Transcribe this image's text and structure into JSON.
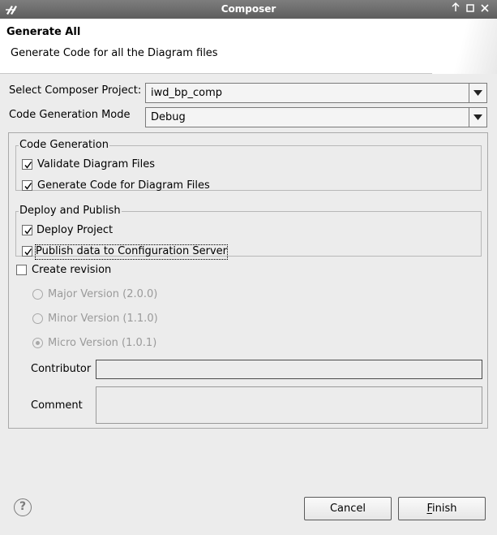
{
  "window": {
    "title": "Composer",
    "controls": [
      "pin-icon",
      "maximize-icon",
      "close-icon"
    ]
  },
  "banner": {
    "title": "Generate All",
    "description": "Generate Code for all the Diagram files"
  },
  "form": {
    "project_label": "Select Composer Project:",
    "project_value": "iwd_bp_comp",
    "mode_label": "Code Generation Mode",
    "mode_value": "Debug"
  },
  "code_generation": {
    "title": "Code Generation",
    "validate_label": "Validate Diagram Files",
    "validate_checked": true,
    "generate_label": "Generate Code for Diagram Files",
    "generate_checked": true
  },
  "deploy_publish": {
    "title": "Deploy and Publish",
    "deploy_label": "Deploy Project",
    "deploy_checked": true,
    "publish_label": "Publish data to Configuration Server",
    "publish_checked": true
  },
  "revision": {
    "create_label": "Create revision",
    "create_checked": false,
    "major_label": "Major Version (2.0.0)",
    "minor_label": "Minor Version (1.1.0)",
    "micro_label": "Micro Version (1.0.1)",
    "selected": "micro",
    "contributor_label": "Contributor",
    "contributor_value": "",
    "comment_label": "Comment",
    "comment_value": ""
  },
  "buttons": {
    "help_glyph": "?",
    "cancel_label": "Cancel",
    "finish_label": "Finish"
  },
  "colors": {
    "titlebar": "#6e6e6e",
    "dialog_bg": "#ececec",
    "banner_bg": "#ffffff",
    "disabled_text": "#9a9a9a"
  }
}
